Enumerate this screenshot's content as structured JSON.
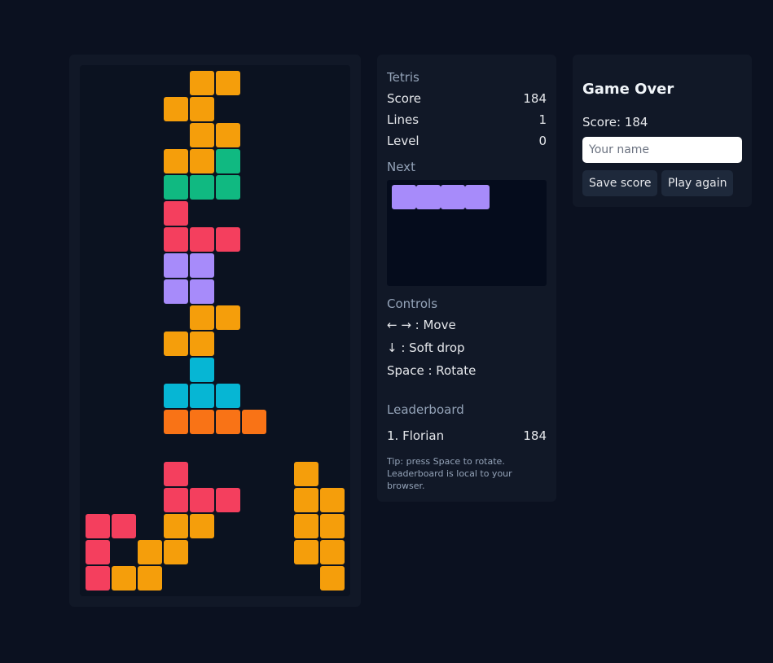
{
  "colors": {
    "O": "#f59e0b",
    "S": "#10b981",
    "Z": "#f43f5e",
    "T": "#a78bfa",
    "J": "#06b6d4",
    "L": "#f97316"
  },
  "board": {
    "columns": 10,
    "rows": 20,
    "cells": [
      {
        "r": 0,
        "c": 4,
        "t": "O"
      },
      {
        "r": 0,
        "c": 5,
        "t": "O"
      },
      {
        "r": 1,
        "c": 3,
        "t": "O"
      },
      {
        "r": 1,
        "c": 4,
        "t": "O"
      },
      {
        "r": 2,
        "c": 4,
        "t": "O"
      },
      {
        "r": 2,
        "c": 5,
        "t": "O"
      },
      {
        "r": 3,
        "c": 3,
        "t": "O"
      },
      {
        "r": 3,
        "c": 4,
        "t": "O"
      },
      {
        "r": 3,
        "c": 5,
        "t": "S"
      },
      {
        "r": 4,
        "c": 3,
        "t": "S"
      },
      {
        "r": 4,
        "c": 4,
        "t": "S"
      },
      {
        "r": 4,
        "c": 5,
        "t": "S"
      },
      {
        "r": 5,
        "c": 3,
        "t": "Z"
      },
      {
        "r": 6,
        "c": 3,
        "t": "Z"
      },
      {
        "r": 6,
        "c": 4,
        "t": "Z"
      },
      {
        "r": 6,
        "c": 5,
        "t": "Z"
      },
      {
        "r": 7,
        "c": 3,
        "t": "T"
      },
      {
        "r": 7,
        "c": 4,
        "t": "T"
      },
      {
        "r": 8,
        "c": 3,
        "t": "T"
      },
      {
        "r": 8,
        "c": 4,
        "t": "T"
      },
      {
        "r": 9,
        "c": 4,
        "t": "O"
      },
      {
        "r": 9,
        "c": 5,
        "t": "O"
      },
      {
        "r": 10,
        "c": 3,
        "t": "O"
      },
      {
        "r": 10,
        "c": 4,
        "t": "O"
      },
      {
        "r": 11,
        "c": 4,
        "t": "J"
      },
      {
        "r": 12,
        "c": 3,
        "t": "J"
      },
      {
        "r": 12,
        "c": 4,
        "t": "J"
      },
      {
        "r": 12,
        "c": 5,
        "t": "J"
      },
      {
        "r": 13,
        "c": 3,
        "t": "L"
      },
      {
        "r": 13,
        "c": 4,
        "t": "L"
      },
      {
        "r": 13,
        "c": 5,
        "t": "L"
      },
      {
        "r": 13,
        "c": 6,
        "t": "L"
      },
      {
        "r": 15,
        "c": 3,
        "t": "Z"
      },
      {
        "r": 15,
        "c": 8,
        "t": "O"
      },
      {
        "r": 16,
        "c": 3,
        "t": "Z"
      },
      {
        "r": 16,
        "c": 4,
        "t": "Z"
      },
      {
        "r": 16,
        "c": 5,
        "t": "Z"
      },
      {
        "r": 16,
        "c": 8,
        "t": "O"
      },
      {
        "r": 16,
        "c": 9,
        "t": "O"
      },
      {
        "r": 17,
        "c": 0,
        "t": "Z"
      },
      {
        "r": 17,
        "c": 1,
        "t": "Z"
      },
      {
        "r": 17,
        "c": 3,
        "t": "O"
      },
      {
        "r": 17,
        "c": 4,
        "t": "O"
      },
      {
        "r": 17,
        "c": 8,
        "t": "O"
      },
      {
        "r": 17,
        "c": 9,
        "t": "O"
      },
      {
        "r": 18,
        "c": 0,
        "t": "Z"
      },
      {
        "r": 18,
        "c": 2,
        "t": "O"
      },
      {
        "r": 18,
        "c": 3,
        "t": "O"
      },
      {
        "r": 18,
        "c": 8,
        "t": "O"
      },
      {
        "r": 18,
        "c": 9,
        "t": "O"
      },
      {
        "r": 19,
        "c": 0,
        "t": "Z"
      },
      {
        "r": 19,
        "c": 1,
        "t": "O"
      },
      {
        "r": 19,
        "c": 2,
        "t": "O"
      },
      {
        "r": 19,
        "c": 9,
        "t": "O"
      }
    ]
  },
  "sidebar": {
    "title": "Tetris",
    "score_label": "Score",
    "score_value": "184",
    "lines_label": "Lines",
    "lines_value": "1",
    "level_label": "Level",
    "level_value": "0",
    "next_label": "Next",
    "next_piece": "I",
    "controls_label": "Controls",
    "controls": [
      "← → : Move",
      "↓ : Soft drop",
      "Space : Rotate"
    ],
    "leaderboard_label": "Leaderboard",
    "leaderboard": [
      {
        "rank_name": "1. Florian",
        "score": "184"
      }
    ],
    "tip": "Tip: press Space to rotate. Leaderboard is local to your browser."
  },
  "game_over": {
    "title": "Game Over",
    "score_text": "Score: 184",
    "name_placeholder": "Your name",
    "name_value": "",
    "save_label": "Save score",
    "play_again_label": "Play again"
  }
}
